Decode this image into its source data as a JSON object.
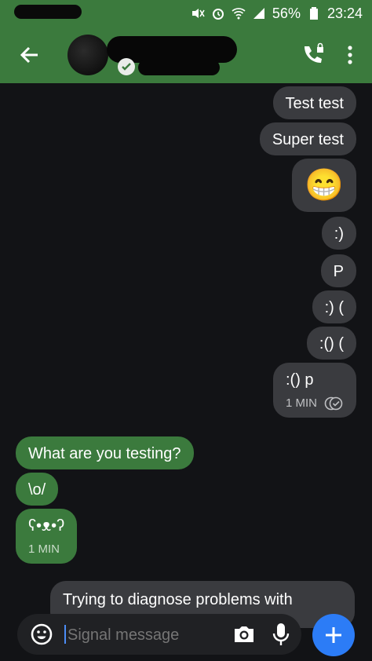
{
  "status_bar": {
    "battery_percent": "56%",
    "time": "23:24",
    "icons": [
      "mute-icon",
      "alarm-icon",
      "wifi-icon",
      "signal-icon",
      "battery-icon"
    ]
  },
  "app_bar": {
    "icons": [
      "back-arrow-icon",
      "verified-check-icon",
      "phone-lock-icon",
      "more-vert-icon"
    ]
  },
  "messages": [
    {
      "dir": "out",
      "text": "Test test"
    },
    {
      "dir": "out",
      "text": "Super test"
    },
    {
      "dir": "out",
      "text": "😁"
    },
    {
      "dir": "out",
      "text": ":)"
    },
    {
      "dir": "out",
      "text": "P"
    },
    {
      "dir": "out",
      "text": ":) ("
    },
    {
      "dir": "out",
      "text": ":() ("
    },
    {
      "dir": "out",
      "text": ":() p",
      "time": "1 MIN",
      "status_icon": "read-receipt-icon"
    },
    {
      "dir": "in",
      "text": "What are you testing?"
    },
    {
      "dir": "in",
      "text": "\\o/"
    },
    {
      "dir": "in",
      "text": "ʕ•ᴥ•ʔ",
      "time": "1 MIN"
    },
    {
      "dir": "out",
      "text": "Trying to diagnose problems with"
    }
  ],
  "composer": {
    "placeholder": "Signal message",
    "icons": [
      "emoji-icon",
      "camera-icon",
      "mic-icon",
      "plus-icon"
    ]
  },
  "colors": {
    "header_green": "#3b7a3d",
    "background": "#121316",
    "outgoing_bubble": "#3a3b3f",
    "incoming_bubble": "#3b7a3d",
    "send_button": "#2c7cf6"
  }
}
